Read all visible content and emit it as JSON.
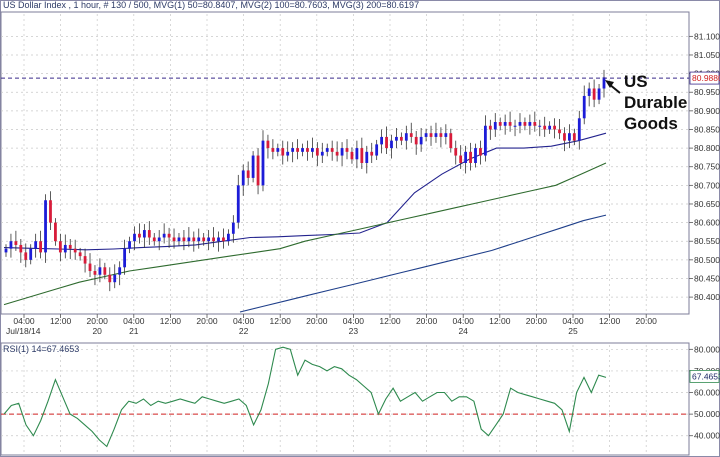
{
  "header": {
    "title": "US Dollar Index , 1 hour, # 130 / 500,",
    "ma1": "MVG(1) 50=80.8407,",
    "ma2": "MVG(2) 100=80.7603,",
    "ma3": "MVG(3) 200=80.6197"
  },
  "rsi_header": "RSI(1) 14=67.4653",
  "annotation": {
    "line1": "US",
    "line2": "Durable",
    "line3": "Goods"
  },
  "colors": {
    "up_candle": "#1c1cd8",
    "down_candle": "#d81c3a",
    "ma1": "#23238e",
    "ma2": "#2f6b2f",
    "ma3": "#1f3f8a",
    "rsi": "#2f8a4f",
    "rsi_ref": "#d02020",
    "price_ref": "#3a2a8a",
    "grid": "#c8c8c8"
  },
  "chart_data": [
    {
      "type": "candlestick",
      "title": "US Dollar Index , 1 hour",
      "ylim": [
        80.36,
        81.16
      ],
      "y_ticks": [
        "81.1000",
        "81.0500",
        "81.0000",
        "80.9500",
        "80.9000",
        "80.8500",
        "80.8000",
        "80.7500",
        "80.7000",
        "80.6500",
        "80.6000",
        "80.5500",
        "80.5000",
        "80.4500",
        "80.4000"
      ],
      "x_ticks": [
        {
          "label": "04:00",
          "date": ""
        },
        {
          "label": "12:00",
          "date": ""
        },
        {
          "label": "20:00",
          "date": "20"
        },
        {
          "label": "04:00",
          "date": "21"
        },
        {
          "label": "12:00",
          "date": ""
        },
        {
          "label": "20:00",
          "date": ""
        },
        {
          "label": "04:00",
          "date": "22"
        },
        {
          "label": "12:00",
          "date": ""
        },
        {
          "label": "20:00",
          "date": ""
        },
        {
          "label": "04:00",
          "date": "23"
        },
        {
          "label": "12:00",
          "date": ""
        },
        {
          "label": "20:00",
          "date": ""
        },
        {
          "label": "04:00",
          "date": "24"
        },
        {
          "label": "12:00",
          "date": ""
        },
        {
          "label": "20:00",
          "date": ""
        },
        {
          "label": "04:00",
          "date": "25"
        },
        {
          "label": "12:00",
          "date": ""
        },
        {
          "label": "20:00",
          "date": ""
        }
      ],
      "first_date_label": "Jul/18/14",
      "current_price": "80.9880",
      "closes": [
        80.53,
        80.55,
        80.54,
        80.52,
        80.5,
        80.53,
        80.55,
        80.52,
        80.66,
        80.6,
        80.55,
        80.52,
        80.54,
        80.53,
        80.52,
        80.51,
        80.49,
        80.47,
        80.46,
        80.48,
        80.46,
        80.44,
        80.46,
        80.48,
        80.53,
        80.55,
        80.57,
        80.56,
        80.58,
        80.56,
        80.55,
        80.56,
        80.57,
        80.56,
        80.55,
        80.56,
        80.55,
        80.56,
        80.55,
        80.56,
        80.55,
        80.56,
        80.55,
        80.56,
        80.55,
        80.57,
        80.6,
        80.7,
        80.74,
        80.72,
        80.78,
        80.7,
        80.82,
        80.8,
        80.79,
        80.8,
        80.78,
        80.79,
        80.8,
        80.79,
        80.8,
        80.79,
        80.8,
        80.78,
        80.79,
        80.8,
        80.79,
        80.78,
        80.8,
        80.79,
        80.77,
        80.8,
        80.76,
        80.79,
        80.78,
        80.81,
        80.83,
        80.8,
        80.82,
        80.83,
        80.82,
        80.84,
        80.83,
        80.81,
        80.83,
        80.84,
        80.83,
        80.84,
        80.83,
        80.84,
        80.8,
        80.78,
        80.76,
        80.79,
        80.76,
        80.8,
        80.78,
        80.86,
        80.85,
        80.87,
        80.86,
        80.87,
        80.86,
        80.86,
        80.87,
        80.86,
        80.87,
        80.86,
        80.86,
        80.85,
        80.86,
        80.85,
        80.84,
        80.82,
        80.84,
        80.82,
        80.88,
        80.94,
        80.96,
        80.93,
        80.96,
        80.99
      ],
      "series": [
        {
          "name": "MVG(1) 50",
          "values": [
            80.533,
            80.531,
            80.529,
            80.527,
            80.529,
            80.533,
            80.536,
            80.54,
            80.55,
            80.56,
            80.562,
            80.565,
            80.568,
            80.572,
            80.6,
            80.68,
            80.73,
            80.77,
            80.8,
            80.8,
            80.805,
            80.82,
            80.84
          ]
        },
        {
          "name": "MVG(2) 100",
          "values": [
            80.38,
            80.4,
            80.42,
            80.44,
            80.455,
            80.47,
            80.48,
            80.49,
            80.5,
            80.51,
            80.52,
            80.53,
            80.55,
            80.565,
            80.58,
            80.595,
            80.61,
            80.625,
            80.64,
            80.655,
            80.67,
            80.685,
            80.7,
            80.73,
            80.76
          ]
        },
        {
          "name": "MVG(3) 200",
          "values": [
            80.36,
            80.375,
            80.39,
            80.405,
            80.42,
            80.435,
            80.45,
            80.465,
            80.48,
            80.495,
            80.51,
            80.525,
            80.545,
            80.565,
            80.585,
            80.605,
            80.62
          ]
        }
      ]
    },
    {
      "type": "line",
      "title": "RSI(1) 14",
      "ylim": [
        32,
        82
      ],
      "y_ticks": [
        "80.0000",
        "70.0000",
        "60.0000",
        "50.0000",
        "40.0000"
      ],
      "reference_line": 50,
      "current_value": "67.4653",
      "values": [
        50,
        54,
        55,
        45,
        40,
        47,
        56,
        66,
        58,
        50,
        48,
        45,
        42,
        38,
        35,
        43,
        52,
        56,
        55,
        57,
        54,
        56,
        55,
        56,
        57,
        56,
        55,
        58,
        57,
        56,
        55,
        56,
        57,
        54,
        45,
        52,
        64,
        80,
        81,
        80,
        68,
        75,
        73,
        72,
        70,
        72,
        71,
        68,
        66,
        63,
        60,
        50,
        57,
        62,
        56,
        58,
        60,
        56,
        58,
        60,
        60,
        56,
        58,
        58,
        56,
        43,
        40,
        45,
        50,
        62,
        60,
        59,
        58,
        57,
        56,
        55,
        52,
        42,
        60,
        67,
        60,
        68,
        67
      ]
    }
  ]
}
